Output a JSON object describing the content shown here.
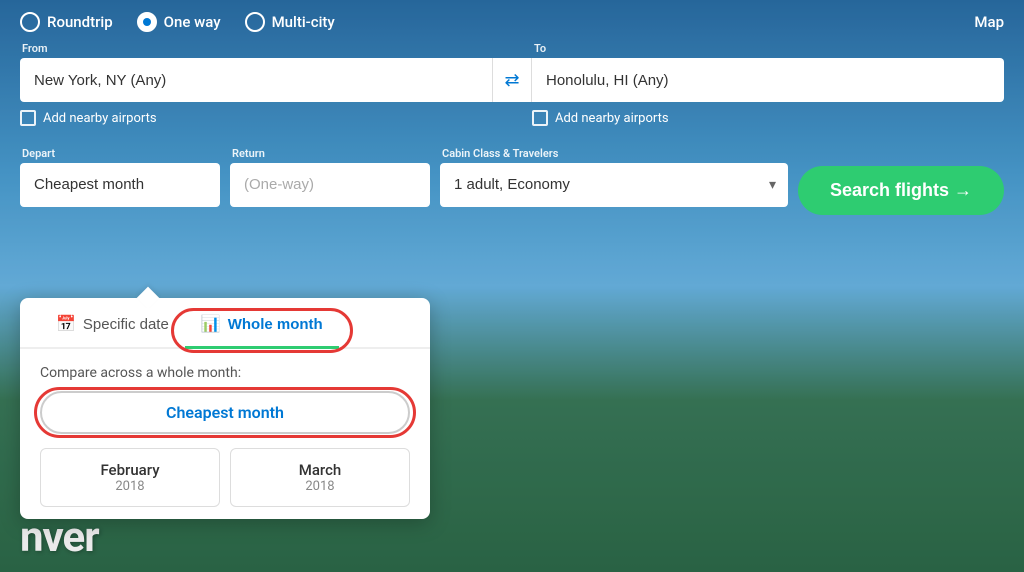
{
  "trip_types": [
    {
      "label": "Roundtrip",
      "selected": false
    },
    {
      "label": "One way",
      "selected": true
    },
    {
      "label": "Multi-city",
      "selected": false
    }
  ],
  "map_label": "Map",
  "from": {
    "label": "From",
    "value": "New York, NY (Any)",
    "placeholder": "From"
  },
  "to": {
    "label": "To",
    "value": "Honolulu, HI (Any)",
    "placeholder": "To"
  },
  "nearby_from": "Add nearby airports",
  "nearby_to": "Add nearby airports",
  "depart": {
    "label": "Depart",
    "value": "Cheapest month"
  },
  "return_field": {
    "label": "Return",
    "value": "(One-way)"
  },
  "cabin": {
    "label": "Cabin Class & Travelers",
    "value": "1 adult, Economy"
  },
  "search_button": "Search flights →",
  "dropdown": {
    "tabs": [
      {
        "label": "Specific date",
        "icon": "📅",
        "active": false
      },
      {
        "label": "Whole month",
        "icon": "📊",
        "active": true
      }
    ],
    "compare_text": "Compare across a whole month:",
    "cheapest_month_label": "Cheapest month",
    "months": [
      {
        "name": "February",
        "year": "2018"
      },
      {
        "name": "March",
        "year": "2018"
      }
    ]
  },
  "bottom_city": "nver"
}
